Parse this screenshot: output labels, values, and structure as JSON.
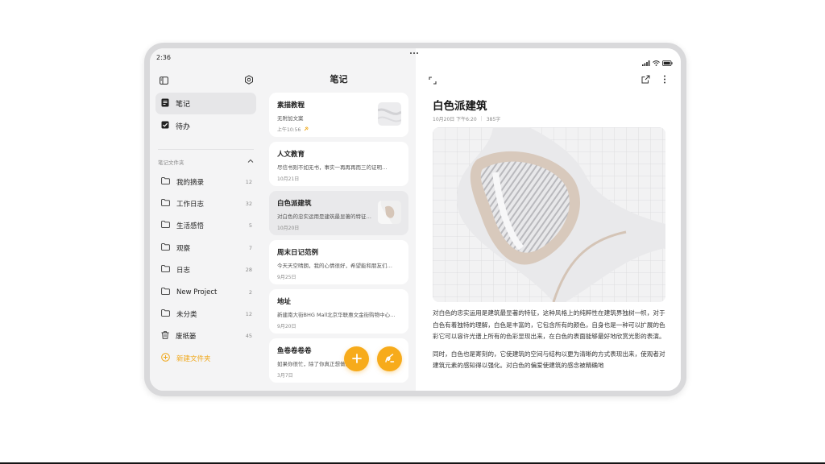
{
  "status_bar": {
    "time": "2:36"
  },
  "sidebar": {
    "nav": [
      {
        "label": "笔记",
        "icon": "note-icon",
        "active": true
      },
      {
        "label": "待办",
        "icon": "checkbox-icon",
        "active": false
      }
    ],
    "folders_header": "笔记文件夹",
    "folders": [
      {
        "name": "我的摘录",
        "count": "12",
        "icon": "folder-icon"
      },
      {
        "name": "工作日志",
        "count": "32",
        "icon": "folder-icon"
      },
      {
        "name": "生活感悟",
        "count": "5",
        "icon": "folder-icon"
      },
      {
        "name": "观察",
        "count": "7",
        "icon": "folder-icon"
      },
      {
        "name": "日志",
        "count": "28",
        "icon": "folder-icon"
      },
      {
        "name": "New Project",
        "count": "2",
        "icon": "folder-icon"
      },
      {
        "name": "未分类",
        "count": "12",
        "icon": "folder-icon"
      },
      {
        "name": "废纸篓",
        "count": "45",
        "icon": "trash-icon"
      }
    ],
    "new_folder": "新建文件夹"
  },
  "list": {
    "title": "笔记",
    "notes": [
      {
        "title": "素描教程",
        "snippet": "无附加文案",
        "date": "上午10:56",
        "has_thumb": true,
        "pinned": true
      },
      {
        "title": "人文教育",
        "snippet": "尽信书则不如无书，事实一再再再而三的证明…",
        "date": "10月21日",
        "has_thumb": false
      },
      {
        "title": "白色派建筑",
        "snippet": "对白色的忠实运用是建筑最显著的特征…",
        "date": "10月20日",
        "has_thumb": true,
        "selected": true
      },
      {
        "title": "周末日记范例",
        "snippet": "今天天空晴朗，我的心情很好，希望能和朋友们…",
        "date": "9月25日",
        "has_thumb": false
      },
      {
        "title": "地址",
        "snippet": "新建南大街BHG Mall北京华联惠文金街购物中心…",
        "date": "9月20日",
        "has_thumb": false
      },
      {
        "title": "鱼卷卷卷卷",
        "snippet": "如果你很忙，除了你真正想做的事…",
        "date": "3月7日",
        "has_thumb": false
      }
    ]
  },
  "detail": {
    "title": "白色派建筑",
    "date": "10月20日 下午6:20",
    "separator": "|",
    "word_count": "385字",
    "paragraphs": [
      "对白色的忠实运用是建筑最显著的特征，这种风格上的纯粹性在建筑界独树一帜，对于白色有着独特的理解，白色是丰富的，它包含所有的颜色，自身也是一种可以扩展的色彩它可以容许光谱上所有的色彩显现出来，在白色的表面能够最好地欣赏光影的表演。",
      "同时，白色也是寄刻的，它使建筑的空间与结构以更为清晰的方式表现出来，使观者对建筑元素的感知得以强化。对白色的偏爱使建筑的感念被精确地"
    ]
  },
  "colors": {
    "accent": "#f7ab1b",
    "sidebar_bg": "#f4f4f5",
    "selected_bg": "#e9e9eb"
  }
}
